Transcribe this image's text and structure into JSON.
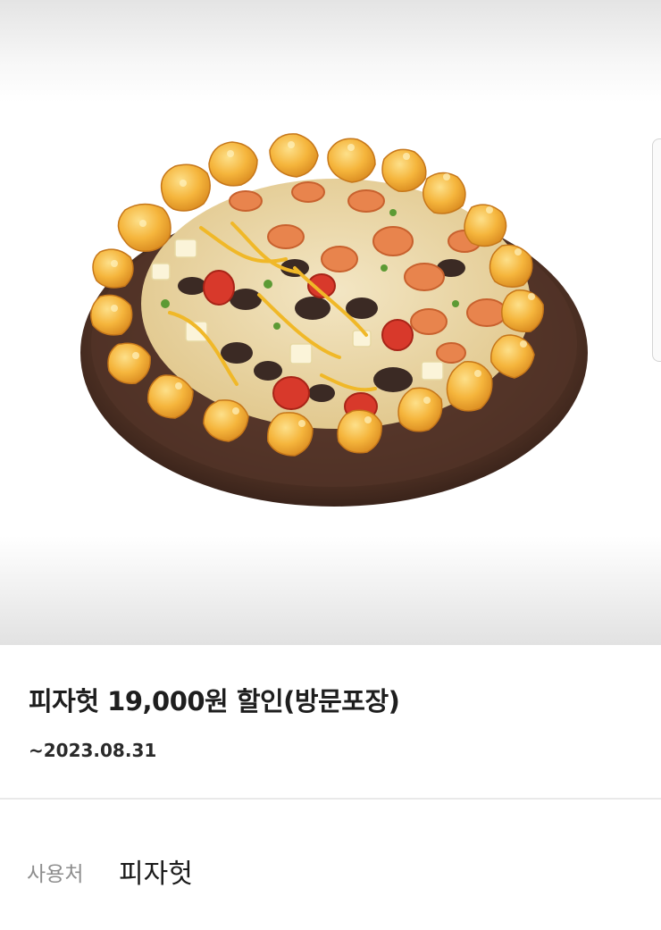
{
  "product": {
    "image_alt": "피자헛 피자 이미지",
    "title": "피자헛 19,000원 할인(방문포장)",
    "expiry": "~2023.08.31"
  },
  "usage": {
    "label": "사용처",
    "value": "피자헛"
  },
  "colors": {
    "title_text": "#1e1e1e",
    "label_text": "#8d8d8d",
    "divider": "#e9e9e9",
    "crust": "#f2b53d",
    "board": "#4a2f24"
  },
  "icons": [
    "pizza-image",
    "side-panel-handle"
  ]
}
